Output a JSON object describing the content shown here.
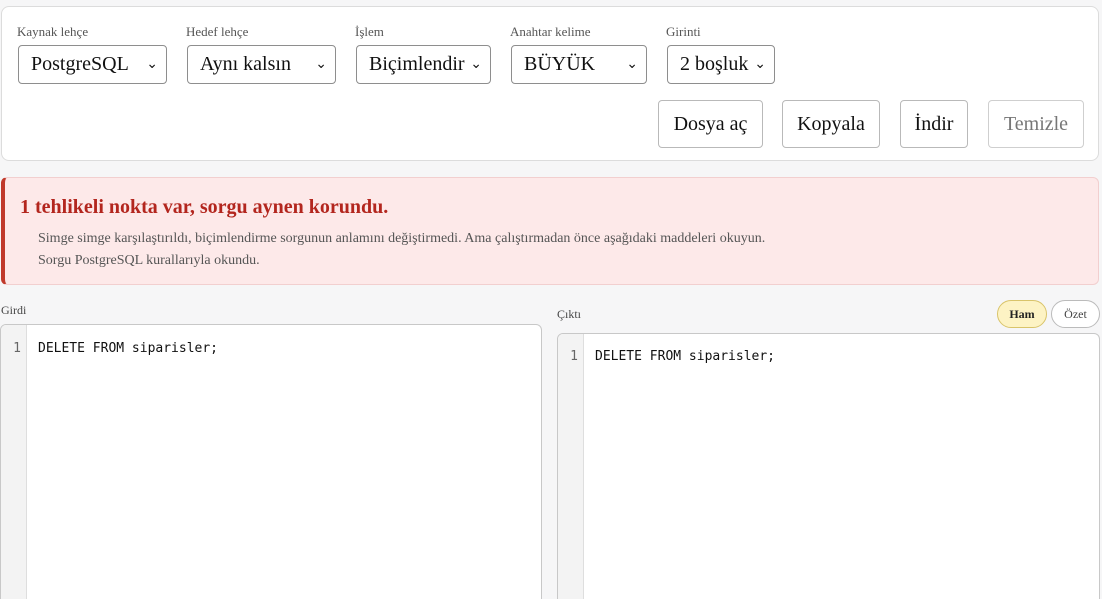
{
  "toolbar": {
    "source_dialect": {
      "label": "Kaynak lehçe",
      "value": "PostgreSQL"
    },
    "target_dialect": {
      "label": "Hedef lehçe",
      "value": "Aynı kalsın"
    },
    "operation": {
      "label": "İşlem",
      "value": "Biçimlendir"
    },
    "keyword_case": {
      "label": "Anahtar kelime",
      "value": "BÜYÜK"
    },
    "indent": {
      "label": "Girinti",
      "value": "2 boşluk"
    },
    "buttons": {
      "open_file": "Dosya aç",
      "copy": "Kopyala",
      "download": "İndir",
      "clear": "Temizle"
    }
  },
  "alert": {
    "title": "1 tehlikeli nokta var, sorgu aynen korundu.",
    "lines": [
      "Simge simge karşılaştırıldı, biçimlendirme sorgunun anlamını değiştirmedi. Ama çalıştırmadan önce aşağıdaki maddeleri okuyun.",
      "Sorgu PostgreSQL kurallarıyla okundu."
    ]
  },
  "input_pane": {
    "label": "Girdi",
    "lines": [
      {
        "number": "1",
        "text": "DELETE FROM siparisler;"
      }
    ]
  },
  "output_pane": {
    "label": "Çıktı",
    "view_toggle": {
      "raw": "Ham",
      "summary": "Özet",
      "selected": "Ham"
    },
    "lines": [
      {
        "number": "1",
        "text": "DELETE FROM siparisler;"
      }
    ]
  },
  "colors": {
    "alert_accent": "#c0392b",
    "alert_title": "#b3261e",
    "alert_background": "#fde9e9",
    "toggle_active": "#fdf3c4"
  },
  "icons": {
    "select_chevron": "chevron-down-icon"
  }
}
